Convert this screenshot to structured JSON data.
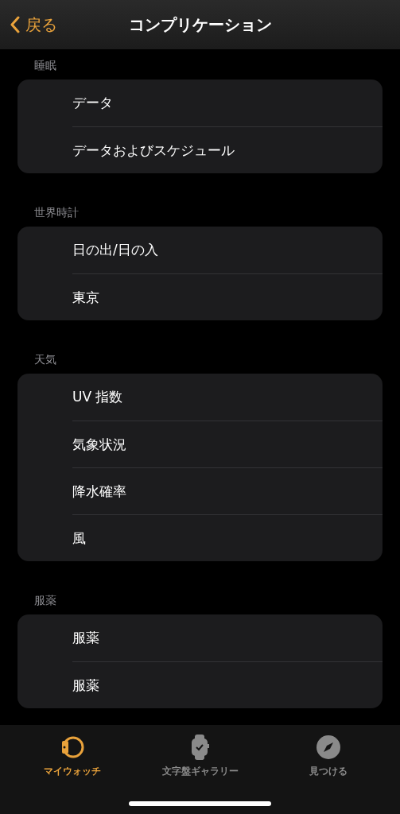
{
  "nav": {
    "back": "戻る",
    "title": "コンプリケーション"
  },
  "sections": [
    {
      "header": "睡眠",
      "rows": [
        "データ",
        "データおよびスケジュール"
      ]
    },
    {
      "header": "世界時計",
      "rows": [
        "日の出/日の入",
        "東京"
      ]
    },
    {
      "header": "天気",
      "rows": [
        "UV 指数",
        "気象状況",
        "降水確率",
        "風"
      ]
    },
    {
      "header": "服薬",
      "rows": [
        "服薬",
        "服薬"
      ]
    }
  ],
  "tabs": [
    {
      "kind": "watch",
      "label": "マイウォッチ",
      "selected": true
    },
    {
      "kind": "face",
      "label": "文字盤ギャラリー",
      "selected": false
    },
    {
      "kind": "compass",
      "label": "見つける",
      "selected": false
    }
  ]
}
